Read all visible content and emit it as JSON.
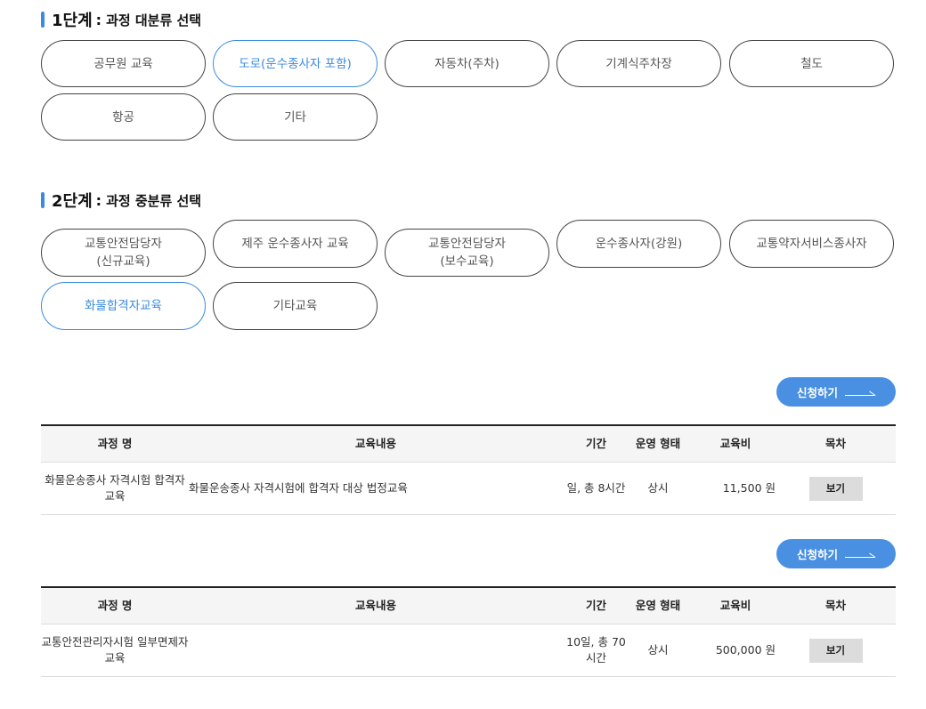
{
  "step1": {
    "num": "1단계",
    "colon": ":",
    "label": "과정 대분류 선택",
    "options": [
      "공무원 교육",
      "도로(운수종사자 포함)",
      "자동차(주차)",
      "기계식주차장",
      "철도",
      "항공",
      "기타"
    ],
    "selected": "도로(운수종사자 포함)"
  },
  "step2": {
    "num": "2단계",
    "colon": ":",
    "label": "과정 중분류 선택",
    "options": [
      "교통안전담당자\n(신규교육)",
      "제주 운수종사자 교육",
      "교통안전담당자\n(보수교육)",
      "운수종사자(강원)",
      "교통약자서비스종사자",
      "화물합격자교육",
      "기타교육"
    ],
    "selected": "화물합격자교육"
  },
  "apply_label": "신청하기",
  "headers": {
    "name": "과정 명",
    "desc": "교육내용",
    "period": "기간",
    "type": "운영 형태",
    "fee": "교육비",
    "toc": "목차"
  },
  "courses": [
    {
      "name": "화물운송종사 자격시험 합격자교육",
      "desc": "화물운송종사 자격시험에 합격자 대상 법정교육",
      "period": "일, 총 8시간",
      "type": "상시",
      "fee": "11,500 원",
      "toc_button": "보기"
    },
    {
      "name": "교통안전관리자시험 일부면제자 교육",
      "desc": "",
      "period": "10일, 총 70시간",
      "type": "상시",
      "fee": "500,000 원",
      "toc_button": "보기"
    }
  ],
  "colors": {
    "accent": "#3a8be0",
    "button": "#4a90e2",
    "view_button_bg": "#dcdcdc"
  }
}
